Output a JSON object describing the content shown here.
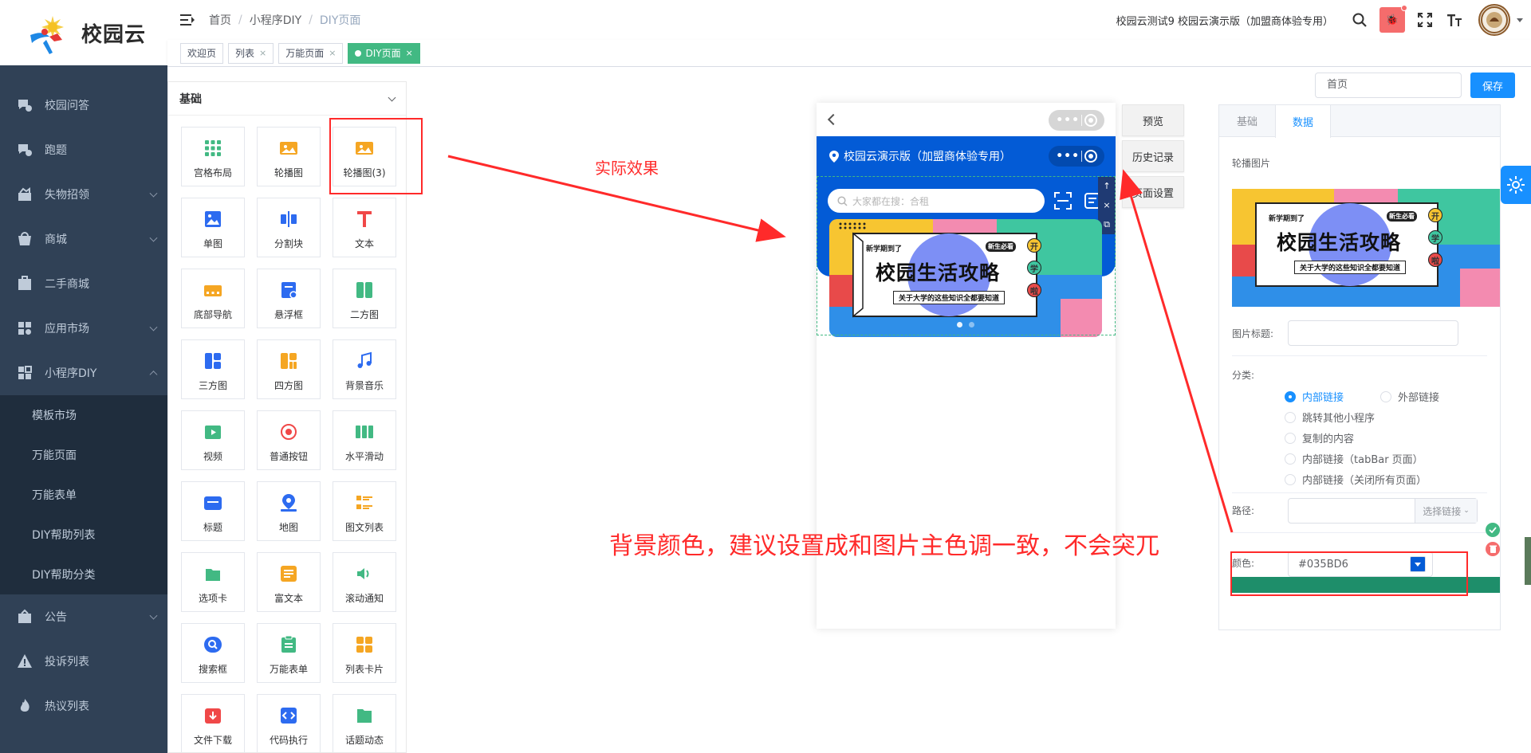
{
  "sidebar": {
    "logo_text": "校园云",
    "menu": [
      {
        "label": "校园问答",
        "icon": "qa-icon"
      },
      {
        "label": "跑题",
        "icon": "chat-icon"
      },
      {
        "label": "失物招领",
        "icon": "box-icon"
      },
      {
        "label": "商城",
        "icon": "shop-icon"
      },
      {
        "label": "二手商城",
        "icon": "store-icon"
      },
      {
        "label": "应用市场",
        "icon": "apps-icon"
      },
      {
        "label": "小程序DIY",
        "icon": "diy-icon"
      }
    ],
    "submenu": [
      "模板市场",
      "万能页面",
      "万能表单",
      "DIY帮助列表",
      "DIY帮助分类"
    ],
    "menu_after": [
      {
        "label": "公告",
        "icon": "notice-icon"
      },
      {
        "label": "投诉列表",
        "icon": "warning-icon"
      },
      {
        "label": "热议列表",
        "icon": "fire-icon"
      }
    ]
  },
  "header": {
    "breadcrumb": [
      "首页",
      "小程序DIY",
      "DIY页面"
    ],
    "org_name": "校园云测试9 校园云演示版（加盟商体验专用）",
    "bug_label": "🐞"
  },
  "tags": [
    {
      "label": "欢迎页",
      "closable": false,
      "active": false
    },
    {
      "label": "列表",
      "closable": true,
      "active": false
    },
    {
      "label": "万能页面",
      "closable": true,
      "active": false
    },
    {
      "label": "DIY页面",
      "closable": true,
      "active": true
    }
  ],
  "toolbar": {
    "page_select": "首页",
    "save_label": "保存"
  },
  "components": {
    "group_title": "基础",
    "items": [
      {
        "label": "宫格布局",
        "color": "#42b983",
        "icon": "grid-icon"
      },
      {
        "label": "轮播图",
        "color": "#f5a623",
        "icon": "image-carousel-icon"
      },
      {
        "label": "轮播图(3)",
        "color": "#f5a623",
        "icon": "image-carousel-icon"
      },
      {
        "label": "单图",
        "color": "#2d6bf0",
        "icon": "image-icon"
      },
      {
        "label": "分割块",
        "color": "#2d6bf0",
        "icon": "divider-icon"
      },
      {
        "label": "文本",
        "color": "#f04848",
        "icon": "text-icon"
      },
      {
        "label": "底部导航",
        "color": "#f5a623",
        "icon": "bottom-nav-icon"
      },
      {
        "label": "悬浮框",
        "color": "#2d6bf0",
        "icon": "float-icon"
      },
      {
        "label": "二方图",
        "color": "#42b983",
        "icon": "two-grid-icon"
      },
      {
        "label": "三方图",
        "color": "#2d6bf0",
        "icon": "three-grid-icon"
      },
      {
        "label": "四方图",
        "color": "#f5a623",
        "icon": "four-grid-icon"
      },
      {
        "label": "背景音乐",
        "color": "#2d6bf0",
        "icon": "music-icon"
      },
      {
        "label": "视频",
        "color": "#42b983",
        "icon": "video-icon"
      },
      {
        "label": "普通按钮",
        "color": "#f04848",
        "icon": "button-icon"
      },
      {
        "label": "水平滑动",
        "color": "#42b983",
        "icon": "slider-icon"
      },
      {
        "label": "标题",
        "color": "#2d6bf0",
        "icon": "title-icon"
      },
      {
        "label": "地图",
        "color": "#2d6bf0",
        "icon": "map-icon"
      },
      {
        "label": "图文列表",
        "color": "#f5a623",
        "icon": "list-icon"
      },
      {
        "label": "选项卡",
        "color": "#42b983",
        "icon": "tab-icon"
      },
      {
        "label": "富文本",
        "color": "#f5a623",
        "icon": "richtext-icon"
      },
      {
        "label": "滚动通知",
        "color": "#42b983",
        "icon": "notice-scroll-icon"
      },
      {
        "label": "搜索框",
        "color": "#2d6bf0",
        "icon": "search-icon"
      },
      {
        "label": "万能表单",
        "color": "#42b983",
        "icon": "form-icon"
      },
      {
        "label": "列表卡片",
        "color": "#f5a623",
        "icon": "card-icon"
      },
      {
        "label": "文件下载",
        "color": "#f04848",
        "icon": "download-icon"
      },
      {
        "label": "代码执行",
        "color": "#2d6bf0",
        "icon": "code-icon"
      },
      {
        "label": "话题动态",
        "color": "#42b983",
        "icon": "topic-icon"
      }
    ]
  },
  "phone": {
    "bar_title": "校园云演示版（加盟商体验专用）",
    "bar_color": "#035BD6",
    "search_placeholder": "大家都在搜：合租",
    "banner": {
      "tag_left": "新学期到了",
      "tag_right": "新生必看",
      "headline": "校园生活攻略",
      "subline": "关于大学的这些知识全都要知道",
      "badges": [
        "开",
        "学",
        "啦"
      ]
    }
  },
  "side_buttons": [
    "预览",
    "历史记录",
    "页面设置"
  ],
  "config": {
    "tabs": [
      "基础",
      "数据"
    ],
    "active_tab": "数据",
    "carousel_label": "轮播图片",
    "image_title_label": "图片标题:",
    "category_label": "分类:",
    "link_options": [
      {
        "label": "内部链接",
        "checked": true
      },
      {
        "label": "外部链接",
        "checked": false
      },
      {
        "label": "跳转其他小程序",
        "checked": false
      },
      {
        "label": "复制的内容",
        "checked": false
      },
      {
        "label": "内部链接（tabBar 页面）",
        "checked": false
      },
      {
        "label": "内部链接（关闭所有页面）",
        "checked": false
      }
    ],
    "path_label": "路径:",
    "select_link_label": "选择链接",
    "color_label": "颜色:",
    "color_value": "#035BD6"
  },
  "annotations": {
    "actual_effect": "实际效果",
    "bg_tip": "背景颜色，建议设置成和图片主色调一致，不会突兀"
  }
}
